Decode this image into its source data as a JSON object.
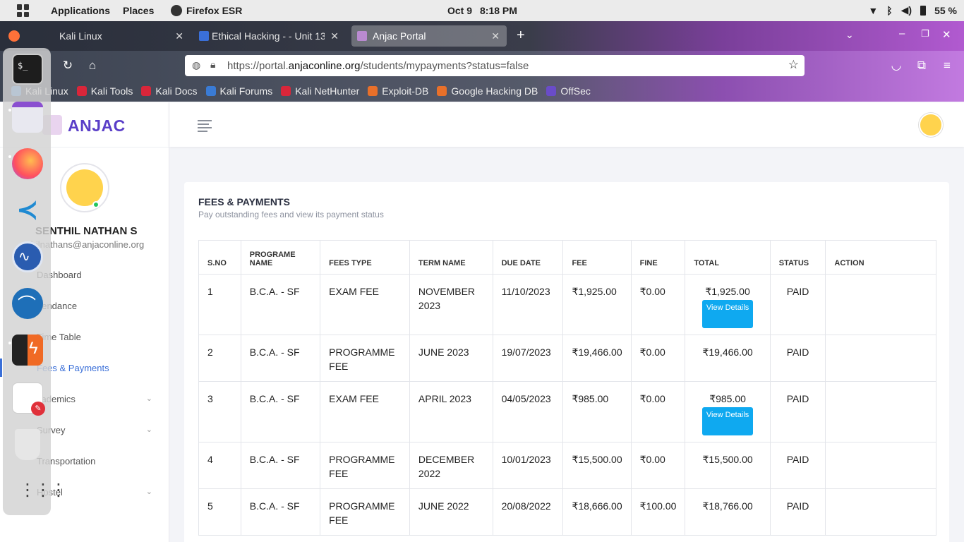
{
  "topbar": {
    "applications": "Applications",
    "places": "Places",
    "firefox_label": "Firefox ESR",
    "date": "Oct 9",
    "time": "8:18 PM",
    "battery": "55 %"
  },
  "tabs": [
    {
      "label": "Kali Linux"
    },
    {
      "label": "Ethical Hacking - - Unit 13"
    },
    {
      "label": "Anjac Portal"
    }
  ],
  "url": {
    "prefix": "https://portal.",
    "domain": "anjaconline.org",
    "path": "/students/mypayments?status=false"
  },
  "bookmarks": [
    {
      "label": "Kali Linux",
      "color": "#4a90d9"
    },
    {
      "label": "Kali Tools",
      "color": "#d9263a"
    },
    {
      "label": "Kali Docs",
      "color": "#d9263a"
    },
    {
      "label": "Kali Forums",
      "color": "#3a7bd5"
    },
    {
      "label": "Kali NetHunter",
      "color": "#d9263a"
    },
    {
      "label": "Exploit-DB",
      "color": "#e8702a"
    },
    {
      "label": "Google Hacking DB",
      "color": "#e8702a"
    },
    {
      "label": "OffSec",
      "color": "#6a4cc9"
    }
  ],
  "brand": "ANJAC",
  "profile": {
    "name": "SENTHIL NATHAN S",
    "email": "thilnathans@anjaconline.org"
  },
  "menu": [
    {
      "label": "Dashboard"
    },
    {
      "label": "ttendance"
    },
    {
      "label": "Time Table"
    },
    {
      "label": "Fees & Payments"
    },
    {
      "label": "cademics"
    },
    {
      "label": "Survey"
    },
    {
      "label": "Transportation"
    },
    {
      "label": "Hostel"
    }
  ],
  "card": {
    "title": "FEES & PAYMENTS",
    "subtitle": "Pay outstanding fees and view its payment status"
  },
  "table": {
    "headers": {
      "sno": "S.NO",
      "programme": "PROGRAME NAME",
      "fees_type": "FEES TYPE",
      "term": "TERM NAME",
      "due": "DUE DATE",
      "fee": "FEE",
      "fine": "FINE",
      "total": "TOTAL",
      "status": "STATUS",
      "action": "ACTION"
    },
    "view_details": "View Details",
    "rows": [
      {
        "sno": "1",
        "programme": "B.C.A. - SF",
        "fees_type": "EXAM FEE",
        "term": "NOVEMBER 2023",
        "due": "11/10/2023",
        "fee": "₹1,925.00",
        "fine": "₹0.00",
        "total": "₹1,925.00",
        "status": "PAID"
      },
      {
        "sno": "2",
        "programme": "B.C.A. - SF",
        "fees_type": "PROGRAMME FEE",
        "term": "JUNE 2023",
        "due": "19/07/2023",
        "fee": "₹19,466.00",
        "fine": "₹0.00",
        "total": "₹19,466.00",
        "status": "PAID"
      },
      {
        "sno": "3",
        "programme": "B.C.A. - SF",
        "fees_type": "EXAM FEE",
        "term": "APRIL 2023",
        "due": "04/05/2023",
        "fee": "₹985.00",
        "fine": "₹0.00",
        "total": "₹985.00",
        "status": "PAID"
      },
      {
        "sno": "4",
        "programme": "B.C.A. - SF",
        "fees_type": "PROGRAMME FEE",
        "term": "DECEMBER 2022",
        "due": "10/01/2023",
        "fee": "₹15,500.00",
        "fine": "₹0.00",
        "total": "₹15,500.00",
        "status": "PAID"
      },
      {
        "sno": "5",
        "programme": "B.C.A. - SF",
        "fees_type": "PROGRAMME FEE",
        "term": "JUNE 2022",
        "due": "20/08/2022",
        "fee": "₹18,666.00",
        "fine": "₹100.00",
        "total": "₹18,766.00",
        "status": "PAID"
      }
    ]
  },
  "icons": {
    "accent": "#3a6fd8",
    "brand_color": "#5a3ec8",
    "button_color": "#0fa9f0"
  }
}
